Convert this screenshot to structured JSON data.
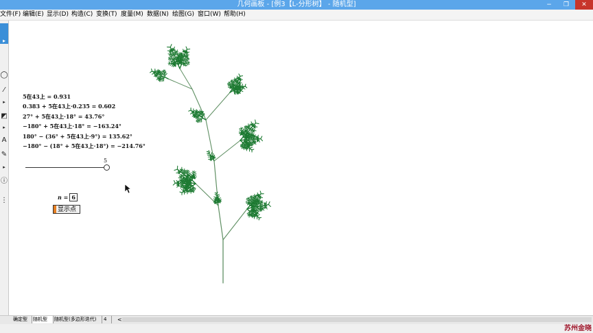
{
  "window": {
    "title": "几何画板 - [例3【L-分形树】 - 随机型]",
    "controls": {
      "minimize": "−",
      "restore": "❐",
      "close": "✕"
    }
  },
  "menu": [
    "文件(F)",
    "编辑(E)",
    "显示(D)",
    "构造(C)",
    "变换(T)",
    "度量(M)",
    "数据(N)",
    "绘图(G)",
    "窗口(W)",
    "帮助(H)"
  ],
  "measurements": [
    "5在43上 = 0.931",
    "0.383 + 5在43上·0.235 = 0.602",
    "27° + 5在43上·18° = 43.76°",
    "−180° + 5在43上·18° = −163.24°",
    "180° − (36° + 5在43上·9°) = 135.62°",
    "−180° − (18° + 5在43上·18°) = −214.76°"
  ],
  "slider": {
    "value_label": "5",
    "fraction": 0.931
  },
  "parameter": {
    "label": "n =",
    "value": "6"
  },
  "show_points_button": "显示点",
  "tabs": [
    "确定型",
    "随机型",
    "随机型(多边形迭代)",
    "4"
  ],
  "active_tab": 1,
  "tab_scroll_arrow": "<",
  "watermark": "苏州金晓",
  "colors": {
    "titlebar": "#5ba6ea",
    "tree_trunk": "#5f8f63",
    "foliage": "#1d7a32",
    "watermark": "#a0192d"
  }
}
